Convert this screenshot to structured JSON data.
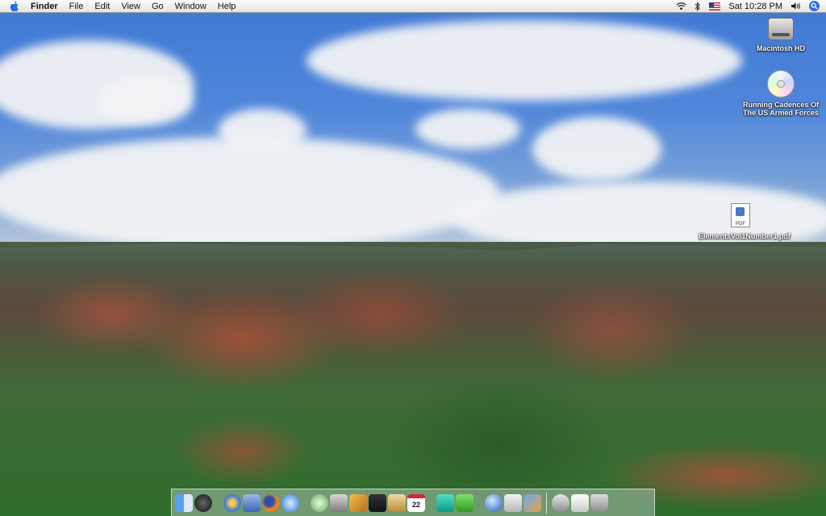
{
  "menubar": {
    "app_name": "Finder",
    "menus": [
      "File",
      "Edit",
      "View",
      "Go",
      "Window",
      "Help"
    ],
    "clock": "Sat 10:28 PM",
    "status_icons": [
      "wifi-icon",
      "bluetooth-icon",
      "us-flag-input-icon",
      "volume-icon",
      "spotlight-icon"
    ]
  },
  "desktop": {
    "icons": [
      {
        "label": "Macintosh HD",
        "icon": "hard-drive-icon"
      },
      {
        "label": "Running Cadences Of The US Armed Forces",
        "icon": "cd-icon"
      },
      {
        "label": "ElementsVol1Number1.pdf",
        "icon": "pdf-document-icon"
      }
    ],
    "pdf_badge": "PDF"
  },
  "dock": {
    "calendar_day": "22",
    "items": [
      "finder-icon",
      "dashboard-icon",
      "system-preferences-icon",
      "preview-icon",
      "firefox-icon",
      "safari-icon",
      "itunes-icon",
      "iphoto-icon",
      "imovie-icon",
      "garageband-icon",
      "address-book-icon",
      "ical-icon",
      "dreamweaver-icon",
      "utility-icon",
      "google-earth-icon",
      "apple-app-icon",
      "photo-app-icon",
      "downloads-stack-icon",
      "mail-document-icon",
      "trash-icon"
    ]
  },
  "colors": {
    "menubar": "#eeeeee",
    "spotlight": "#2b6fe0",
    "sky": "#4f86da"
  }
}
